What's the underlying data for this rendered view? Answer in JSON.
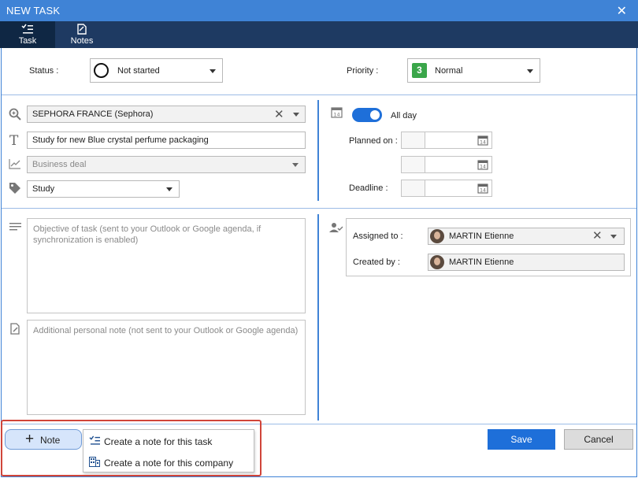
{
  "window": {
    "title": "NEW TASK",
    "close_glyph": "✕"
  },
  "tabs": [
    {
      "label": "Task",
      "icon": "checklist-icon",
      "active": true
    },
    {
      "label": "Notes",
      "icon": "notes-icon",
      "active": false
    }
  ],
  "status": {
    "label": "Status :",
    "value": "Not started"
  },
  "priority": {
    "label": "Priority :",
    "badge": "3",
    "value": "Normal",
    "badge_color": "#3aa64a"
  },
  "company": {
    "value": "SEPHORA FRANCE (Sephora)"
  },
  "title_field": {
    "value": "Study for new Blue crystal perfume packaging"
  },
  "deal": {
    "placeholder": "Business deal"
  },
  "category": {
    "value": "Study"
  },
  "schedule": {
    "allday_label": "All day",
    "allday_on": true,
    "calendar_day": "14",
    "planned_label": "Planned on :",
    "deadline_label": "Deadline :"
  },
  "objective": {
    "placeholder": "Objective of task (sent to your Outlook or Google agenda, if synchronization is enabled)"
  },
  "personal_note": {
    "placeholder": "Additional personal note (not sent to your Outlook or Google agenda)"
  },
  "assignment": {
    "assigned_label": "Assigned to :",
    "assigned_name": "MARTIN Etienne",
    "created_label": "Created by :",
    "created_name": "MARTIN Etienne"
  },
  "footer": {
    "note_button": "Note",
    "save": "Save",
    "cancel": "Cancel",
    "menu": [
      {
        "label": "Create a note for this task",
        "icon": "checklist-icon"
      },
      {
        "label": "Create a note for this company",
        "icon": "building-icon"
      }
    ]
  },
  "colors": {
    "accent": "#3f83d6",
    "tabbar": "#1e3a62",
    "primary_button": "#1e6fd9",
    "highlight": "#d0453a"
  }
}
